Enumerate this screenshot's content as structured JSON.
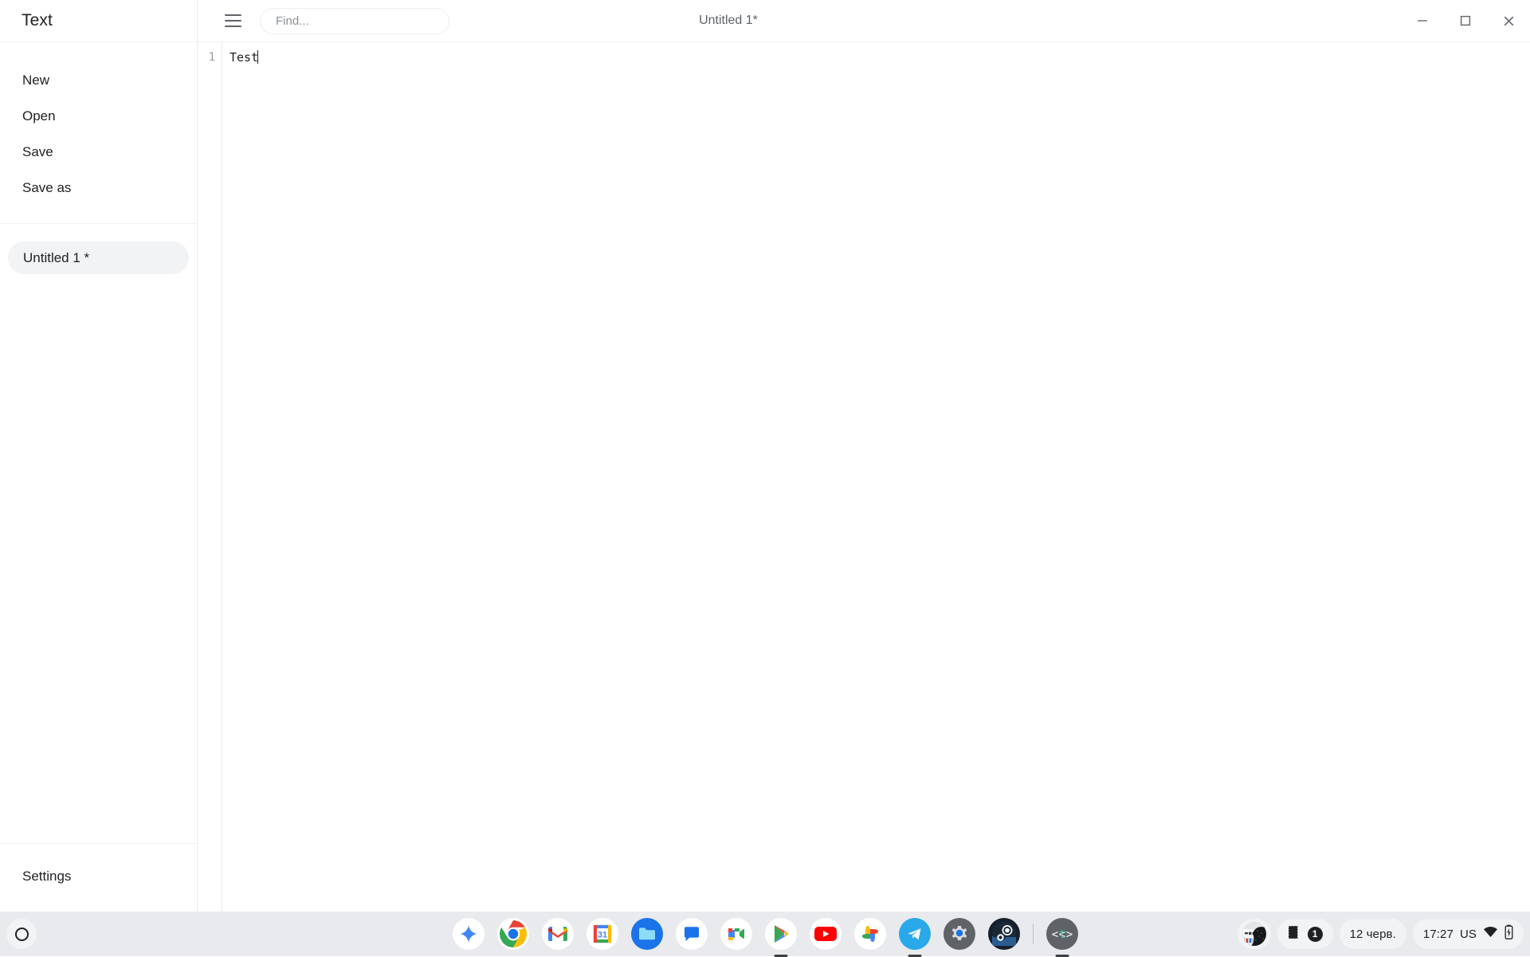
{
  "app": {
    "name": "Text",
    "window_title": "Untitled 1*"
  },
  "toolbar": {
    "menu_icon": "hamburger-icon",
    "find_placeholder": "Find...",
    "find_value": ""
  },
  "window_controls": {
    "minimize": "minimize-icon",
    "maximize": "maximize-icon",
    "close": "close-icon"
  },
  "sidebar": {
    "menu_items": [
      {
        "label": "New"
      },
      {
        "label": "Open"
      },
      {
        "label": "Save"
      },
      {
        "label": "Save as"
      }
    ],
    "files": [
      {
        "label": "Untitled 1 *",
        "active": true
      }
    ],
    "footer_items": [
      {
        "label": "Settings"
      }
    ]
  },
  "editor": {
    "lines": [
      {
        "number": "1",
        "text": "Test"
      }
    ]
  },
  "shelf": {
    "launcher": "launcher-icon",
    "apps": [
      {
        "name": "gemini",
        "label": "Gemini",
        "running": false
      },
      {
        "name": "chrome",
        "label": "Google Chrome",
        "running": false
      },
      {
        "name": "gmail",
        "label": "Gmail",
        "running": false
      },
      {
        "name": "calendar",
        "label": "Calendar",
        "day": "31",
        "running": false
      },
      {
        "name": "files",
        "label": "Files",
        "running": false
      },
      {
        "name": "chat",
        "label": "Google Chat",
        "running": false
      },
      {
        "name": "meet",
        "label": "Google Meet",
        "running": false
      },
      {
        "name": "play-store",
        "label": "Play Store",
        "running": true
      },
      {
        "name": "youtube",
        "label": "YouTube",
        "running": false
      },
      {
        "name": "photos",
        "label": "Google Photos",
        "running": false
      },
      {
        "name": "telegram",
        "label": "Telegram",
        "running": true
      },
      {
        "name": "settings",
        "label": "Settings",
        "running": false
      },
      {
        "name": "steam",
        "label": "Steam",
        "running": false
      },
      {
        "name": "text-editor",
        "label": "Text",
        "running": true
      }
    ],
    "status": {
      "avatar": "user-avatar",
      "cast_icon": "screen-capture-icon",
      "notification_count": "1",
      "date": "12 черв.",
      "time": "17:27",
      "keyboard_layout": "US",
      "wifi_icon": "wifi-icon",
      "battery_icon": "battery-charging-icon"
    }
  },
  "colors": {
    "shelf_bg": "#e8eaed",
    "pod_bg": "#f1f3f4",
    "text_primary": "#202124",
    "text_secondary": "#5f6368",
    "border": "#e8eaed"
  }
}
